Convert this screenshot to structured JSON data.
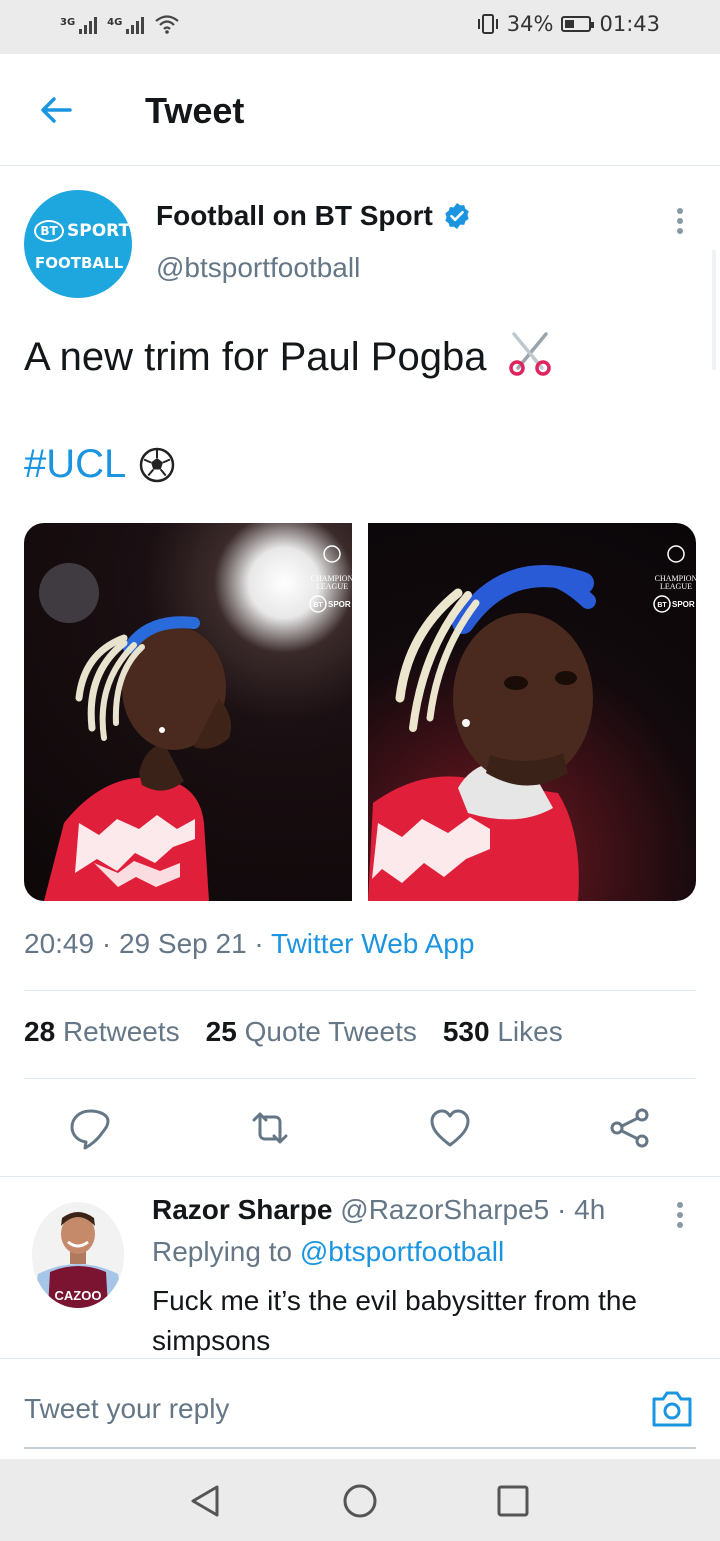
{
  "status_bar": {
    "network1": "3G",
    "network2": "4G",
    "battery": "34%",
    "time": "01:43"
  },
  "header": {
    "title": "Tweet"
  },
  "tweet": {
    "author": {
      "name": "Football on BT Sport",
      "handle": "@btsportfootball",
      "avatar_line1_bt": "BT",
      "avatar_line1_rest": "SPORT",
      "avatar_line2": "FOOTBALL",
      "verified": true
    },
    "text": "A new trim for Paul Pogba",
    "hashtag": "#UCL",
    "time": "20:49",
    "date": "29 Sep 21",
    "source": "Twitter Web App",
    "media_watermark": {
      "line1": "CHAMPION",
      "line2": "LEAGUE",
      "brand_bt": "BT",
      "brand_rest": "SPOR"
    },
    "stats": {
      "retweets_count": "28",
      "retweets_label": "Retweets",
      "quotes_count": "25",
      "quotes_label": "Quote Tweets",
      "likes_count": "530",
      "likes_label": "Likes"
    }
  },
  "reply": {
    "name": "Razor Sharpe",
    "handle": "@RazorSharpe5",
    "time": "4h",
    "replying_label": "Replying to",
    "replying_to": "@btsportfootball",
    "text": "Fuck me it’s the evil babysitter from the simpsons",
    "avatar_shirt_text": "CAZOO"
  },
  "compose": {
    "placeholder": "Tweet your reply"
  },
  "colors": {
    "accent": "#1b95e0",
    "muted": "#657786",
    "bt_blue": "#1ea7df"
  }
}
